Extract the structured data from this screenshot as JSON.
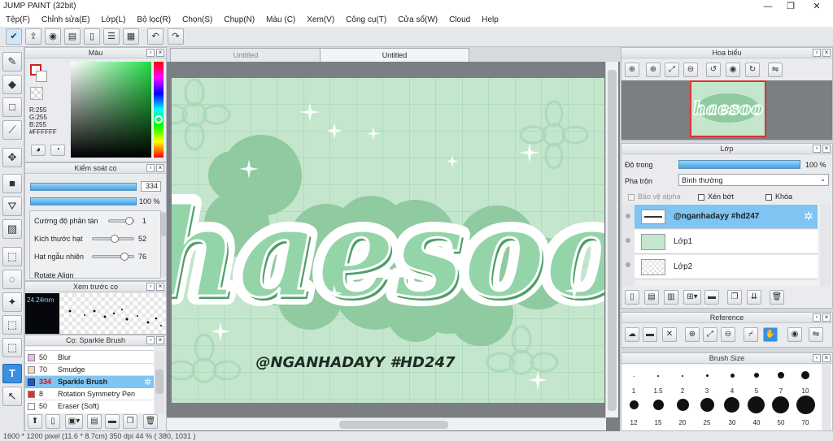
{
  "app": {
    "title": "JUMP PAINT (32bit)",
    "window_controls": [
      "—",
      "❐",
      "✕"
    ]
  },
  "menu": [
    "Tệp(F)",
    "Chỉnh sửa(E)",
    "Lớp(L)",
    "Bộ lọc(R)",
    "Chọn(S)",
    "Chụp(N)",
    "Màu (C)",
    "Xem(V)",
    "Công cụ(T)",
    "Cửa sổ(W)",
    "Cloud",
    "Help"
  ],
  "toolbar": {
    "icons": [
      "check-icon",
      "share-icon",
      "speech-bubble-icon",
      "comment-icon",
      "document-icon",
      "list-icon",
      "grid-icon",
      "undo-icon",
      "redo-icon"
    ]
  },
  "color_panel": {
    "title": "Màu",
    "r": "R:255",
    "g": "G:255",
    "b": "B:255",
    "hex": "#FFFFFF"
  },
  "brush_control": {
    "title": "Kiểm soát cọ",
    "size_value": "334",
    "opacity_value": "100 %",
    "params": [
      {
        "label": "Cường độ phân tán",
        "value": "1"
      },
      {
        "label": "Kích thước hạt",
        "value": "52"
      },
      {
        "label": "Hạt ngẫu nhiên",
        "value": "76"
      },
      {
        "label": "Rotate Align",
        "value": ""
      }
    ]
  },
  "preview": {
    "title": "Xem trước cọ",
    "size": "24.24mm"
  },
  "brush_list": {
    "title": "Cọ: Sparkle Brush",
    "items": [
      {
        "size": "50",
        "name": "Blur",
        "color": "#f0b4f0"
      },
      {
        "size": "70",
        "name": "Smudge",
        "color": "#f5d9b8"
      },
      {
        "size": "334",
        "name": "Sparkle Brush",
        "color": "#2a4fd8",
        "selected": true
      },
      {
        "size": "8",
        "name": "Rotation Symmetry Pen",
        "color": "#e23030"
      },
      {
        "size": "50",
        "name": "Eraser (Soft)",
        "color": "#ffffff"
      }
    ]
  },
  "tabs": [
    "Untitled",
    "Untitled"
  ],
  "artwork": {
    "title": "haesoo",
    "tag": "@NGANHADAYY #HD247"
  },
  "navigator": {
    "title": "Hoa biểu"
  },
  "layers": {
    "title": "Lớp",
    "opacity_label": "Độ trong",
    "opacity_value": "100 %",
    "blend_label": "Pha trộn",
    "blend_value": "Bình thường",
    "protect_alpha": "Bảo vệ alpha",
    "clipping": "Xén bớt",
    "lock": "Khóa",
    "items": [
      {
        "name": "@nganhadayy #hd247",
        "selected": true
      },
      {
        "name": "Lớp1"
      },
      {
        "name": "Lớp2"
      }
    ]
  },
  "reference": {
    "title": "Reference"
  },
  "brush_size": {
    "title": "Brush Size",
    "row1": [
      "1",
      "1.5",
      "2",
      "3",
      "4",
      "5",
      "7",
      "10"
    ],
    "row2": [
      "12",
      "15",
      "20",
      "25",
      "30",
      "40",
      "50",
      "70"
    ]
  },
  "status": "1600 * 1200 pixel   (11.6 * 8.7cm)   350 dpi   44 %   ( 380, 1031 )",
  "colors": {
    "accent": "#3ba2e8",
    "selected_row": "#7fc4f2",
    "canvas_bg": "#c3e6cd",
    "text_green": "#5aaa72"
  }
}
